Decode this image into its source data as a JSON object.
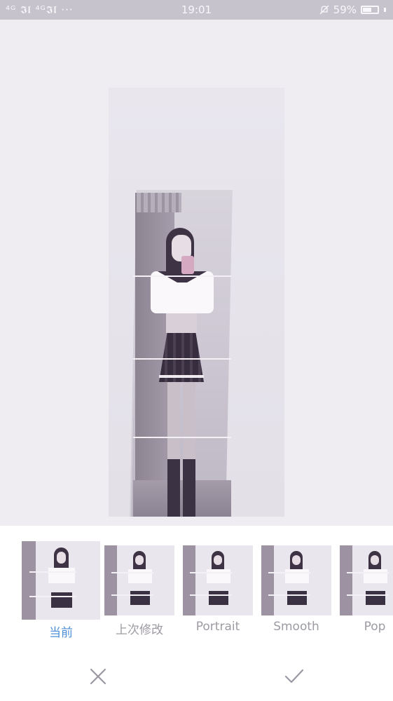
{
  "status_bar": {
    "left": "⁴ᴳ 𝕴𝖑 ⁴ᴳ𝕴𝖑 ···",
    "time": "19:01",
    "battery": "59%",
    "battery_level": 0.59
  },
  "filters": [
    {
      "label": "当前",
      "selected": true
    },
    {
      "label": "上次修改",
      "selected": false
    },
    {
      "label": "Portrait",
      "selected": false
    },
    {
      "label": "Smooth",
      "selected": false
    },
    {
      "label": "Pop",
      "selected": false
    }
  ],
  "colors": {
    "accent": "#4f8fd8",
    "status_bar": "#c7c3cc",
    "background": "#efecf2"
  },
  "icons": {
    "cancel": "close-icon",
    "confirm": "check-icon",
    "notification": "bell-off-icon"
  }
}
